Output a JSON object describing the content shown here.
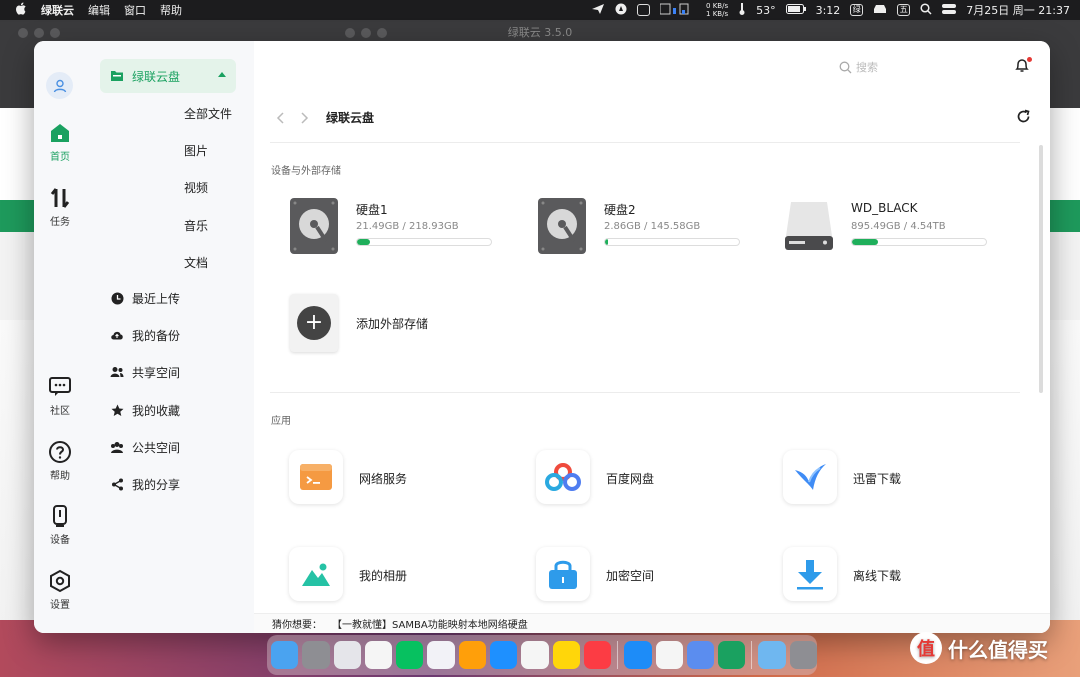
{
  "menubar": {
    "app_name": "绿联云",
    "menus": [
      "编辑",
      "窗口",
      "帮助"
    ],
    "net_up": "0 KB/s",
    "net_down": "1 KB/s",
    "temp": "53°",
    "battery_time": "3:12",
    "datetime": "7月25日 周一 21:37"
  },
  "bg_window": {
    "title": "绿联云 3.5.0"
  },
  "nav1": {
    "items": [
      {
        "label": "首页"
      },
      {
        "label": "任务"
      },
      {
        "label": "社区"
      },
      {
        "label": "帮助"
      },
      {
        "label": "设备"
      },
      {
        "label": "设置"
      }
    ]
  },
  "nav2": {
    "top": {
      "label": "绿联云盘"
    },
    "sub": [
      "全部文件",
      "图片",
      "视频",
      "音乐",
      "文档"
    ],
    "items": [
      {
        "label": "最近上传"
      },
      {
        "label": "我的备份"
      },
      {
        "label": "共享空间"
      },
      {
        "label": "我的收藏"
      },
      {
        "label": "公共空间"
      },
      {
        "label": "我的分享"
      }
    ]
  },
  "header": {
    "search_placeholder": "搜索"
  },
  "toolbar": {
    "breadcrumb": "绿联云盘"
  },
  "storage": {
    "section_title": "设备与外部存储",
    "disks": [
      {
        "name": "硬盘1",
        "size": "21.49GB / 218.93GB",
        "usage": 0.098
      },
      {
        "name": "硬盘2",
        "size": "2.86GB / 145.58GB",
        "usage": 0.02
      },
      {
        "name": "WD_BLACK",
        "size": "895.49GB / 4.54TB",
        "usage": 0.193
      }
    ],
    "add_label": "添加外部存储"
  },
  "apps": {
    "section_title": "应用",
    "items": [
      {
        "label": "网络服务"
      },
      {
        "label": "百度网盘"
      },
      {
        "label": "迅雷下载"
      },
      {
        "label": "我的相册"
      },
      {
        "label": "加密空间"
      },
      {
        "label": "离线下载"
      }
    ]
  },
  "footer": {
    "prefix": "猜你想要：",
    "text": "【一教就懂】SAMBA功能映射本地网络硬盘"
  },
  "watermark": {
    "text": "什么值得买"
  },
  "colors": {
    "accent": "#1aa160",
    "bar": "#1faf5b"
  }
}
